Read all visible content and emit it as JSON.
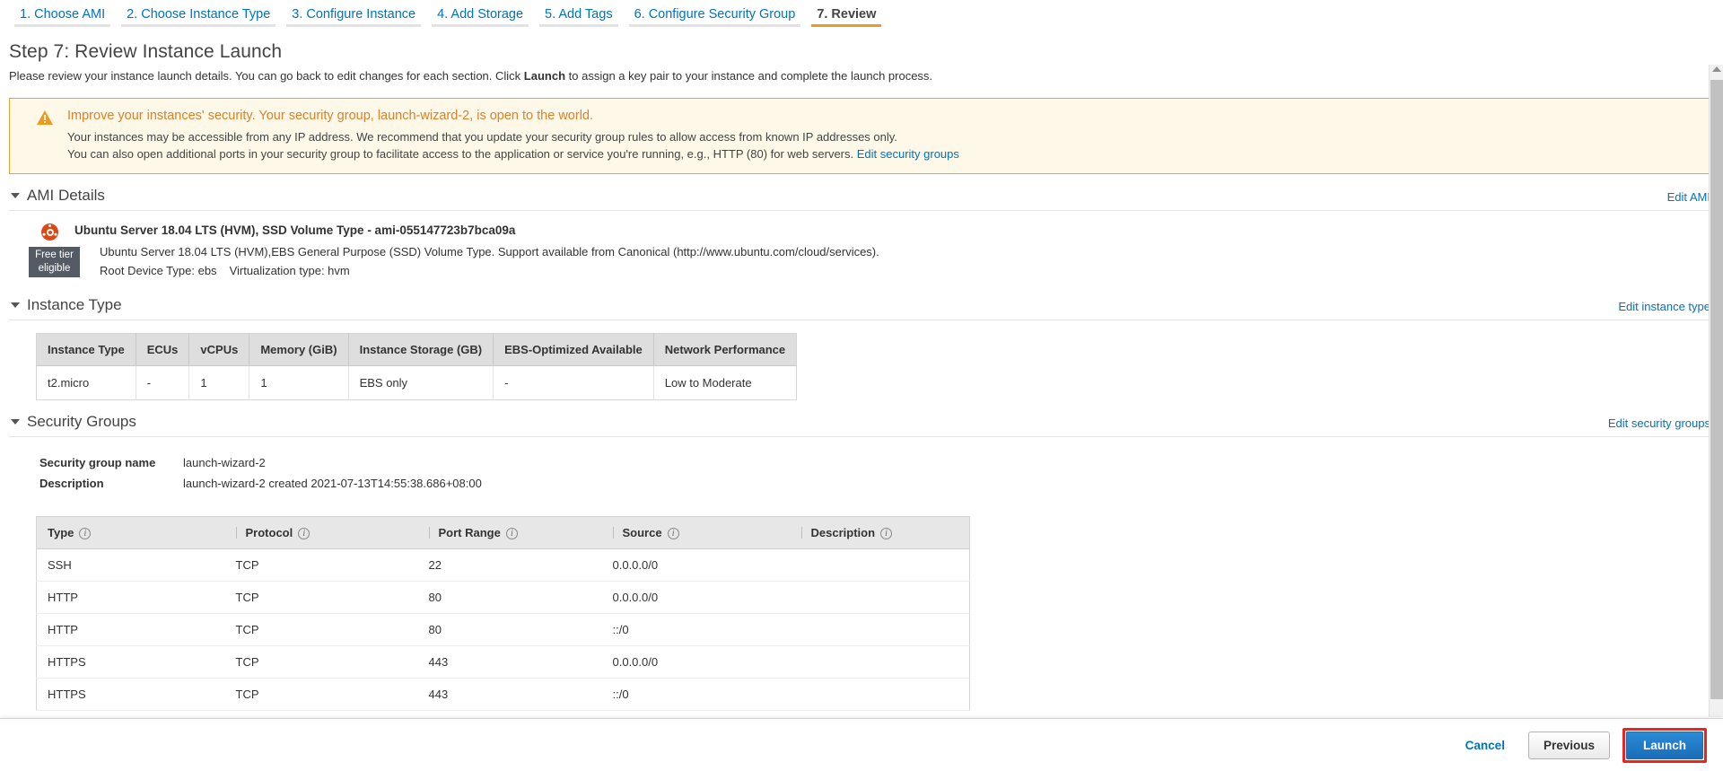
{
  "wizard": {
    "tabs": [
      {
        "label": "1. Choose AMI",
        "active": false
      },
      {
        "label": "2. Choose Instance Type",
        "active": false
      },
      {
        "label": "3. Configure Instance",
        "active": false
      },
      {
        "label": "4. Add Storage",
        "active": false
      },
      {
        "label": "5. Add Tags",
        "active": false
      },
      {
        "label": "6. Configure Security Group",
        "active": false
      },
      {
        "label": "7. Review",
        "active": true
      }
    ]
  },
  "page": {
    "title": "Step 7: Review Instance Launch",
    "description_pre": "Please review your instance launch details. You can go back to edit changes for each section. Click ",
    "description_bold": "Launch",
    "description_post": " to assign a key pair to your instance and complete the launch process."
  },
  "alert": {
    "icon": "warning-triangle-icon",
    "title": "Improve your instances' security. Your security group, launch-wizard-2, is open to the world.",
    "line1": "Your instances may be accessible from any IP address. We recommend that you update your security group rules to allow access from known IP addresses only.",
    "line2_pre": "You can also open additional ports in your security group to facilitate access to the application or service you're running, e.g., HTTP (80) for web servers. ",
    "line2_link": "Edit security groups"
  },
  "ami_section": {
    "title": "AMI Details",
    "edit_label": "Edit AMI",
    "logo": "ubuntu-logo-icon",
    "name": "Ubuntu Server 18.04 LTS (HVM), SSD Volume Type - ami-055147723b7bca09a",
    "badge_line1": "Free tier",
    "badge_line2": "eligible",
    "description": "Ubuntu Server 18.04 LTS (HVM),EBS General Purpose (SSD) Volume Type. Support available from Canonical (http://www.ubuntu.com/cloud/services).",
    "root_device_type": "Root Device Type: ebs",
    "virtualization_type": "Virtualization type: hvm"
  },
  "instance_section": {
    "title": "Instance Type",
    "edit_label": "Edit instance type",
    "columns": [
      "Instance Type",
      "ECUs",
      "vCPUs",
      "Memory (GiB)",
      "Instance Storage (GB)",
      "EBS-Optimized Available",
      "Network Performance"
    ],
    "rows": [
      {
        "instance_type": "t2.micro",
        "ecus": "-",
        "vcpus": "1",
        "memory": "1",
        "instance_storage": "EBS only",
        "ebs_optimized": "-",
        "network_performance": "Low to Moderate"
      }
    ]
  },
  "security_section": {
    "title": "Security Groups",
    "edit_label": "Edit security groups",
    "group_name_label": "Security group name",
    "group_name_value": "launch-wizard-2",
    "description_label": "Description",
    "description_value": "launch-wizard-2 created 2021-07-13T14:55:38.686+08:00",
    "columns": [
      "Type",
      "Protocol",
      "Port Range",
      "Source",
      "Description"
    ],
    "rows": [
      {
        "type": "SSH",
        "protocol": "TCP",
        "port_range": "22",
        "source": "0.0.0.0/0",
        "description": ""
      },
      {
        "type": "HTTP",
        "protocol": "TCP",
        "port_range": "80",
        "source": "0.0.0.0/0",
        "description": ""
      },
      {
        "type": "HTTP",
        "protocol": "TCP",
        "port_range": "80",
        "source": "::/0",
        "description": ""
      },
      {
        "type": "HTTPS",
        "protocol": "TCP",
        "port_range": "443",
        "source": "0.0.0.0/0",
        "description": ""
      },
      {
        "type": "HTTPS",
        "protocol": "TCP",
        "port_range": "443",
        "source": "::/0",
        "description": ""
      }
    ]
  },
  "footer": {
    "cancel_label": "Cancel",
    "previous_label": "Previous",
    "launch_label": "Launch"
  },
  "colors": {
    "accent_blue": "#0073bb",
    "active_orange": "#ec9b20",
    "alert_border": "#e7a52d",
    "alert_bg": "#fdf8e8",
    "alert_text": "#d9822b",
    "ubuntu_orange": "#dd4814",
    "badge_bg": "#545b64",
    "launch_highlight": "#e8251f"
  }
}
